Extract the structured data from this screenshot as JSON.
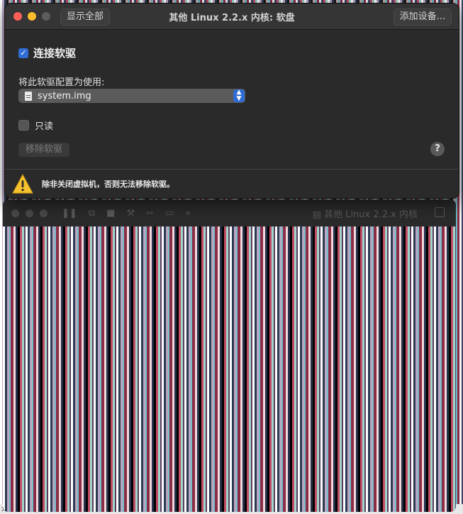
{
  "sheet": {
    "title": "其他 Linux 2.2.x 内核: 软盘",
    "show_all_label": "显示全部",
    "add_device_label": "添加设备...",
    "connect_checked": true,
    "connect_label": "连接软驱",
    "config_label": "将此软驱配置为使用:",
    "image_value": "system.img",
    "readonly_checked": false,
    "readonly_label": "只读",
    "remove_label": "移除软驱",
    "help_label": "?",
    "warning_text": "除非关闭虚拟机，否则无法移除软驱。"
  },
  "vm_window": {
    "title": "其他 Linux 2.2.x 内核"
  },
  "background": {
    "bottom_text": "x 2.2.x 内核"
  },
  "colors": {
    "accent": "#2f6cd4",
    "close": "#ff5f57",
    "minimize": "#febc2e",
    "warning": "#f5c12e"
  }
}
